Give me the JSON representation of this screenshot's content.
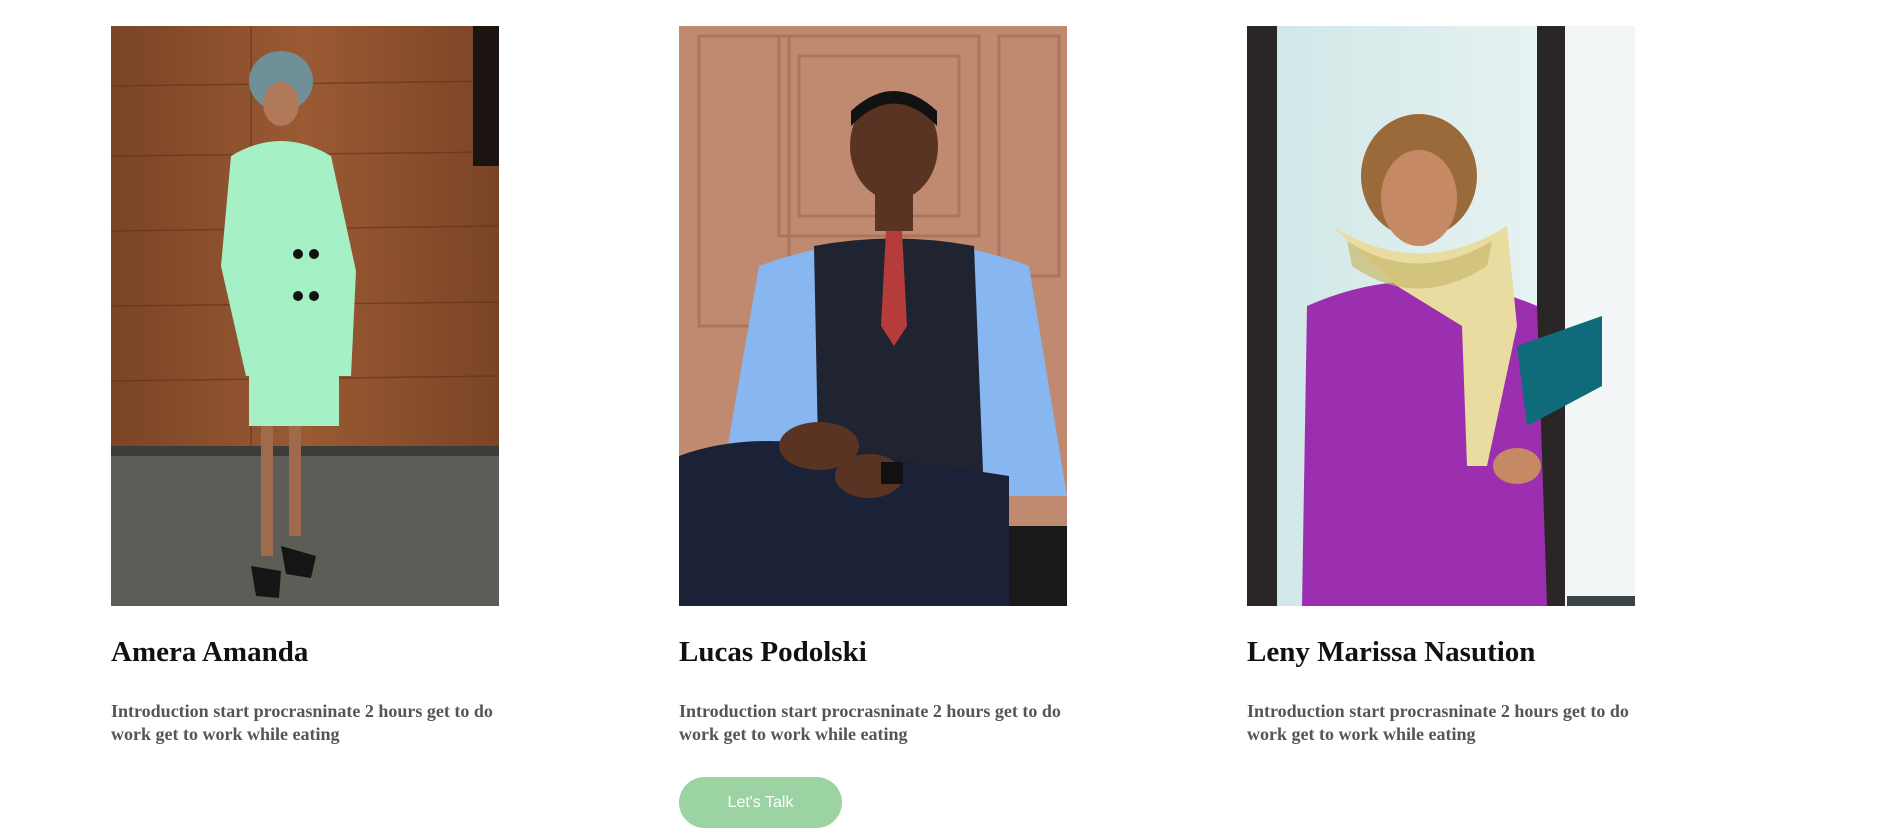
{
  "team": {
    "members": [
      {
        "name": "Amera Amanda",
        "intro": "Introduction start procrasninate 2 hours get to do work get to work while eating",
        "photo_alt": "Amera Amanda"
      },
      {
        "name": "Lucas Podolski",
        "intro": "Introduction start procrasninate 2 hours get to do work get to work while eating",
        "photo_alt": "Lucas Podolski",
        "cta_label": "Let's Talk"
      },
      {
        "name": "Leny Marissa Nasution",
        "intro": "Introduction start procrasninate 2 hours get to do work get to work while eating",
        "photo_alt": "Leny Marissa Nasution"
      }
    ]
  },
  "colors": {
    "cta_background": "#9bd3a2",
    "cta_text": "#ffffff",
    "name_text": "#111111",
    "intro_text": "#555555"
  }
}
